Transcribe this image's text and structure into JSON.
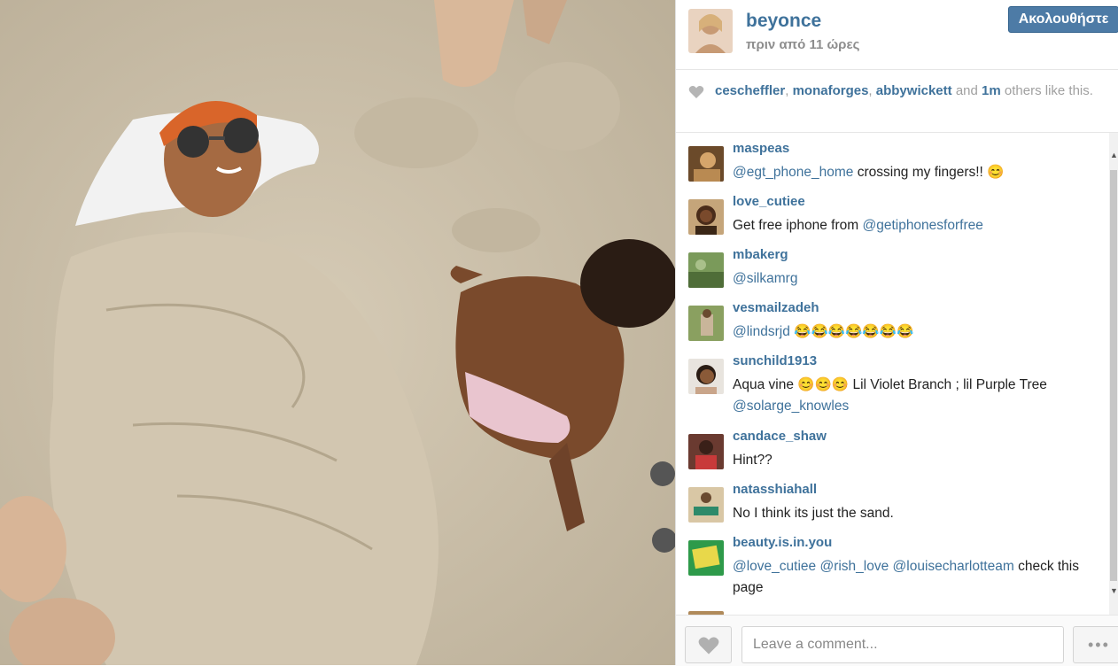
{
  "post": {
    "username": "beyonce",
    "time": "πριν από 11 ώρες",
    "follow_label": "Ακολουθήστε"
  },
  "likes": {
    "users": [
      "cescheffler",
      "monaforges",
      "abbywickett"
    ],
    "and": "and",
    "count": "1m",
    "suffix": "others like this."
  },
  "comments": [
    {
      "user": "maspeas",
      "parts": [
        {
          "t": "@egt_phone_home",
          "m": true
        },
        {
          "t": " crossing my fingers!! 😊",
          "m": false
        }
      ]
    },
    {
      "user": "love_cutiee",
      "parts": [
        {
          "t": "Get free iphone from ",
          "m": false
        },
        {
          "t": "@getiphonesforfree",
          "m": true
        }
      ]
    },
    {
      "user": "mbakerg",
      "parts": [
        {
          "t": "@silkamrg",
          "m": true
        }
      ]
    },
    {
      "user": "vesmailzadeh",
      "parts": [
        {
          "t": "@lindsrjd",
          "m": true
        },
        {
          "t": " 😂😂😂😂😂😂😂",
          "m": false
        }
      ]
    },
    {
      "user": "sunchild1913",
      "parts": [
        {
          "t": "Aqua vine 😊😊😊 Lil Violet Branch ; lil Purple Tree ",
          "m": false
        },
        {
          "t": "@solarge_knowles",
          "m": true
        }
      ]
    },
    {
      "user": "candace_shaw",
      "parts": [
        {
          "t": "Hint??",
          "m": false
        }
      ]
    },
    {
      "user": "natasshiahall",
      "parts": [
        {
          "t": "No I think its just the sand.",
          "m": false
        }
      ]
    },
    {
      "user": "beauty.is.in.you",
      "parts": [
        {
          "t": "@love_cutiee",
          "m": true
        },
        {
          "t": " ",
          "m": false
        },
        {
          "t": "@rish_love",
          "m": true
        },
        {
          "t": " ",
          "m": false
        },
        {
          "t": "@louisecharlotteam",
          "m": true
        },
        {
          "t": " check this page",
          "m": false
        }
      ]
    }
  ],
  "comment_box": {
    "placeholder": "Leave a comment...",
    "more_label": "•••"
  },
  "colors": {
    "link": "#3f729b",
    "follow_bg": "#4d7ba6",
    "sand": "#cbbfa9"
  },
  "icons": [
    "heart-icon",
    "more-dots-icon",
    "scroll-up-icon",
    "scroll-down-icon"
  ]
}
